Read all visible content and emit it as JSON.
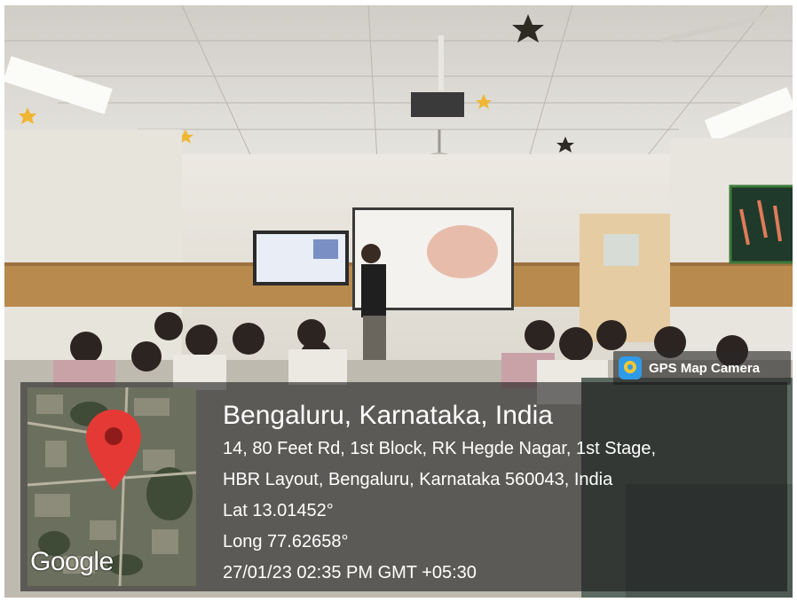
{
  "app_badge": {
    "label": "GPS Map Camera",
    "icon": "gps-map-camera-icon"
  },
  "location": {
    "city": "Bengaluru, Karnataka, India",
    "address_line1": "14, 80 Feet Rd, 1st Block, RK Hegde Nagar, 1st Stage,",
    "address_line2": "HBR Layout, Bengaluru, Karnataka 560043, India",
    "latitude": "Lat 13.01452°",
    "longitude": "Long 77.62658°",
    "datetime": "27/01/23 02:35 PM GMT +05:30"
  },
  "map": {
    "watermark": "Google",
    "pin_icon": "map-pin-icon"
  },
  "colors": {
    "pin": "#e53935",
    "overlay": "#141414",
    "badge_icon": "#2f9be8"
  }
}
